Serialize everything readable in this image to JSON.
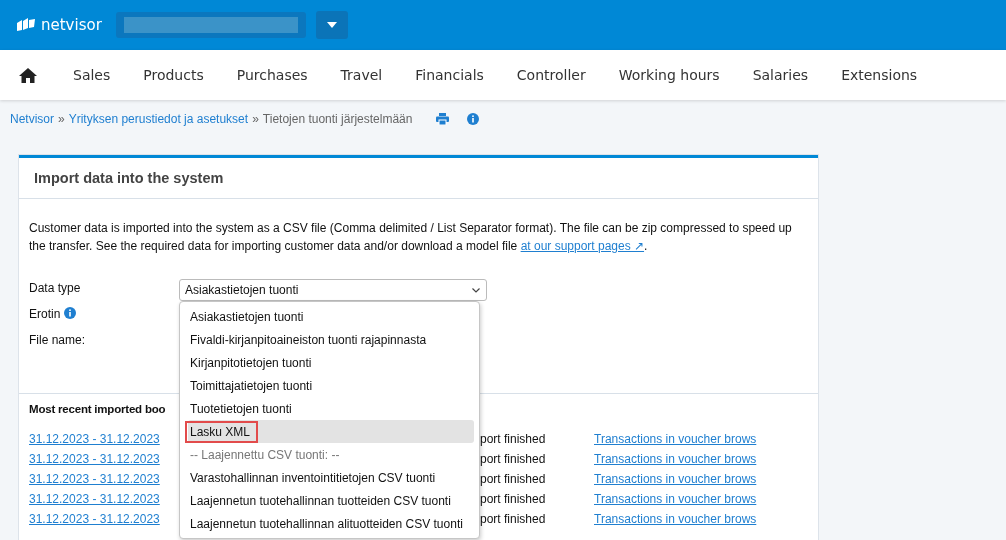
{
  "header": {
    "logo": "netvisor"
  },
  "nav": [
    {
      "label": "Sales",
      "selected": false
    },
    {
      "label": "Products",
      "selected": false
    },
    {
      "label": "Purchases",
      "selected": false
    },
    {
      "label": "Travel",
      "selected": false
    },
    {
      "label": "Financials",
      "selected": false
    },
    {
      "label": "Controller",
      "selected": false
    },
    {
      "label": "Working hours",
      "selected": false
    },
    {
      "label": "Salaries",
      "selected": false
    },
    {
      "label": "Extensions",
      "selected": false
    }
  ],
  "breadcrumb": {
    "links": [
      "Netvisor",
      "Yrityksen perustiedot ja asetukset"
    ],
    "separator": "»",
    "current": "Tietojen tuonti järjestelmään"
  },
  "card": {
    "title": "Import data into the system",
    "intro": "Customer data is imported into the system as a CSV file (Comma delimited / List Separator format). The file can be zip compressed to speed up the transfer. See the required data for importing customer data and/or download a model file",
    "intro_link": "at our support pages ↗",
    "intro_end": ".",
    "fields": [
      {
        "label": "Data type",
        "info": false
      },
      {
        "label": "Erotin",
        "info": true
      },
      {
        "label": "File name:",
        "info": false
      }
    ],
    "select_value": "Asiakastietojen tuonti",
    "options": [
      {
        "label": "Asiakastietojen tuonti",
        "kind": "option",
        "selected": false
      },
      {
        "label": "Fivaldi-kirjanpitoaineiston tuonti rajapinnasta",
        "kind": "option",
        "selected": false
      },
      {
        "label": "Kirjanpitotietojen tuonti",
        "kind": "option",
        "selected": false
      },
      {
        "label": "Toimittajatietojen tuonti",
        "kind": "option",
        "selected": false
      },
      {
        "label": "Tuotetietojen tuonti",
        "kind": "option",
        "selected": false
      },
      {
        "label": "Lasku XML",
        "kind": "option",
        "selected": true,
        "highlighted": true
      },
      {
        "label": "-- Laajennettu CSV tuonti: --",
        "kind": "group",
        "selected": false
      },
      {
        "label": "Varastohallinnan inventointitietojen CSV tuonti",
        "kind": "option",
        "selected": false
      },
      {
        "label": "Laajennetun tuotehallinnan tuotteiden CSV tuonti",
        "kind": "option",
        "selected": false
      },
      {
        "label": "Laajennetun tuotehallinnan alituotteiden CSV tuonti",
        "kind": "option",
        "selected": false
      }
    ],
    "recent_title": "Most recent imported boo",
    "rows": [
      {
        "period": "31.12.2023 - 31.12.2023",
        "status": "port finished",
        "link": "Transactions in voucher brows"
      },
      {
        "period": "31.12.2023 - 31.12.2023",
        "status": "port finished",
        "link": "Transactions in voucher brows"
      },
      {
        "period": "31.12.2023 - 31.12.2023",
        "status": "port finished",
        "link": "Transactions in voucher brows"
      },
      {
        "period": "31.12.2023 - 31.12.2023",
        "status": "port finished",
        "link": "Transactions in voucher brows"
      },
      {
        "period": "31.12.2023 - 31.12.2023",
        "status": "port finished",
        "link": "Transactions in voucher brows"
      }
    ]
  }
}
